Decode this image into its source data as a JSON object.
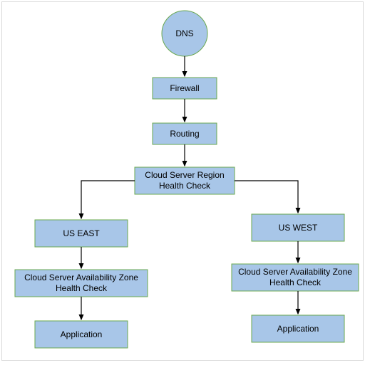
{
  "diagram": {
    "dns": "DNS",
    "firewall": "Firewall",
    "routing": "Routing",
    "region_check": "Cloud Server Region Health Check",
    "east": {
      "region": "US EAST",
      "az_check": "Cloud Server Availability Zone Health Check",
      "app": "Application"
    },
    "west": {
      "region": "US WEST",
      "az_check": "Cloud Server Availability Zone Health Check",
      "app": "Application"
    }
  },
  "colors": {
    "node_fill": "#a8c6e8",
    "node_stroke": "#6aa84f",
    "arrow": "#000000"
  }
}
